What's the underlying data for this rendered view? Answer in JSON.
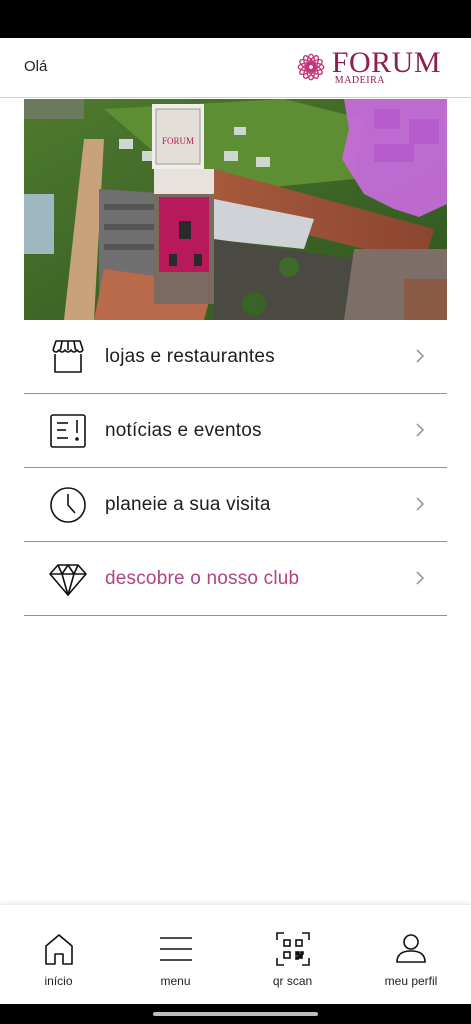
{
  "header": {
    "greeting": "Olá",
    "logo_name": "FORUM",
    "logo_sub": "MADEIRA"
  },
  "hero": {
    "sign_text": "FORUM"
  },
  "menu": {
    "items": [
      {
        "label": "lojas e restaurantes",
        "icon": "storefront-icon"
      },
      {
        "label": "notícias e eventos",
        "icon": "news-icon"
      },
      {
        "label": "planeie a sua visita",
        "icon": "clock-icon"
      },
      {
        "label": "descobre o nosso club",
        "icon": "diamond-icon"
      }
    ]
  },
  "tabbar": {
    "tabs": [
      {
        "label": "início",
        "icon": "home-icon"
      },
      {
        "label": "menu",
        "icon": "hamburger-icon"
      },
      {
        "label": "qr scan",
        "icon": "qr-scan-icon"
      },
      {
        "label": "meu perfil",
        "icon": "profile-icon"
      }
    ]
  },
  "colors": {
    "brand": "#8c1f4f",
    "accent_text": "#b24384",
    "hero_overlay": "#c86bdc"
  }
}
